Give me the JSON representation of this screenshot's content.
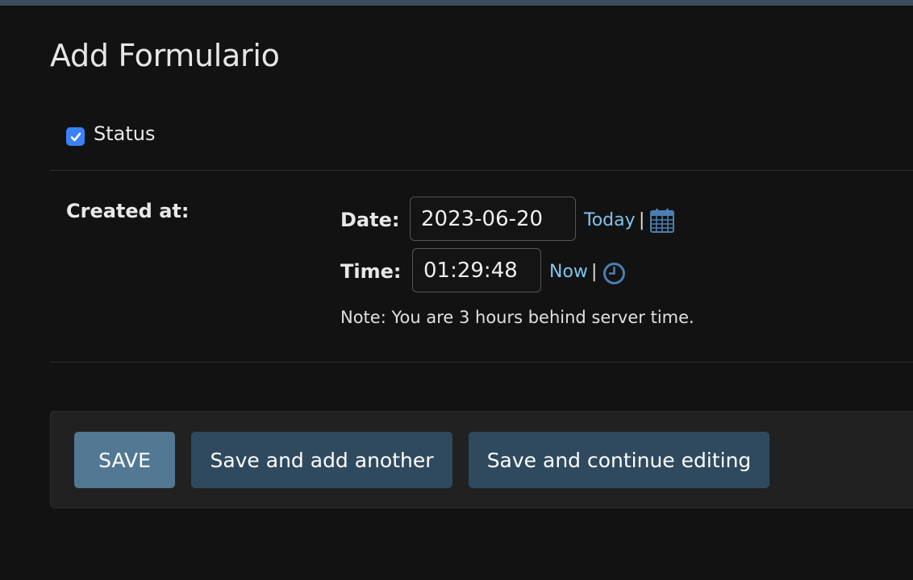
{
  "page": {
    "title": "Add Formulario"
  },
  "status": {
    "label": "Status",
    "checked": true
  },
  "created_at": {
    "label": "Created at:",
    "date": {
      "label": "Date:",
      "value": "2023-06-20",
      "shortcut": "Today",
      "separator": "|",
      "icon": "calendar-icon"
    },
    "time": {
      "label": "Time:",
      "value": "01:29:48",
      "shortcut": "Now",
      "separator": "|",
      "icon": "clock-icon"
    },
    "note": "Note: You are 3 hours behind server time."
  },
  "actions": {
    "save": "SAVE",
    "save_add_another": "Save and add another",
    "save_continue": "Save and continue editing"
  },
  "colors": {
    "background": "#121212",
    "top_bar": "#3a4d5f",
    "link": "#7fc4ef",
    "primary_button": "#527893",
    "secondary_button": "#2f4a5e",
    "checkbox": "#3b82f6"
  }
}
